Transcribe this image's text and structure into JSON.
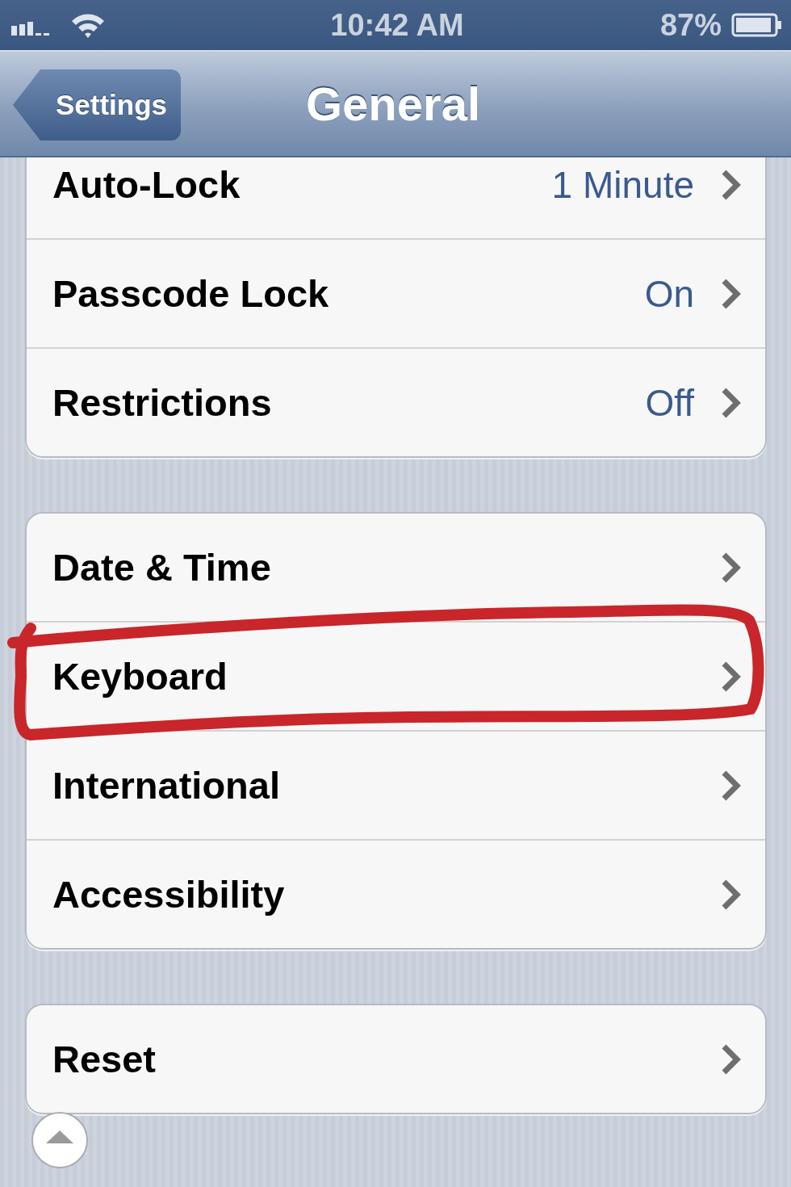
{
  "status_bar": {
    "time": "10:42 AM",
    "battery": "87%"
  },
  "nav_bar": {
    "back": "Settings",
    "title": "General"
  },
  "groups": [
    {
      "rows": [
        {
          "label": "Auto-Lock",
          "value": "1 Minute",
          "highlighted": false
        },
        {
          "label": "Passcode Lock",
          "value": "On",
          "highlighted": false
        },
        {
          "label": "Restrictions",
          "value": "Off",
          "highlighted": false
        }
      ]
    },
    {
      "rows": [
        {
          "label": "Date & Time",
          "highlighted": false
        },
        {
          "label": "Keyboard",
          "highlighted": true
        },
        {
          "label": "International",
          "highlighted": false
        },
        {
          "label": "Accessibility",
          "highlighted": false
        }
      ]
    },
    {
      "rows": [
        {
          "label": "Reset",
          "highlighted": false
        }
      ]
    }
  ]
}
